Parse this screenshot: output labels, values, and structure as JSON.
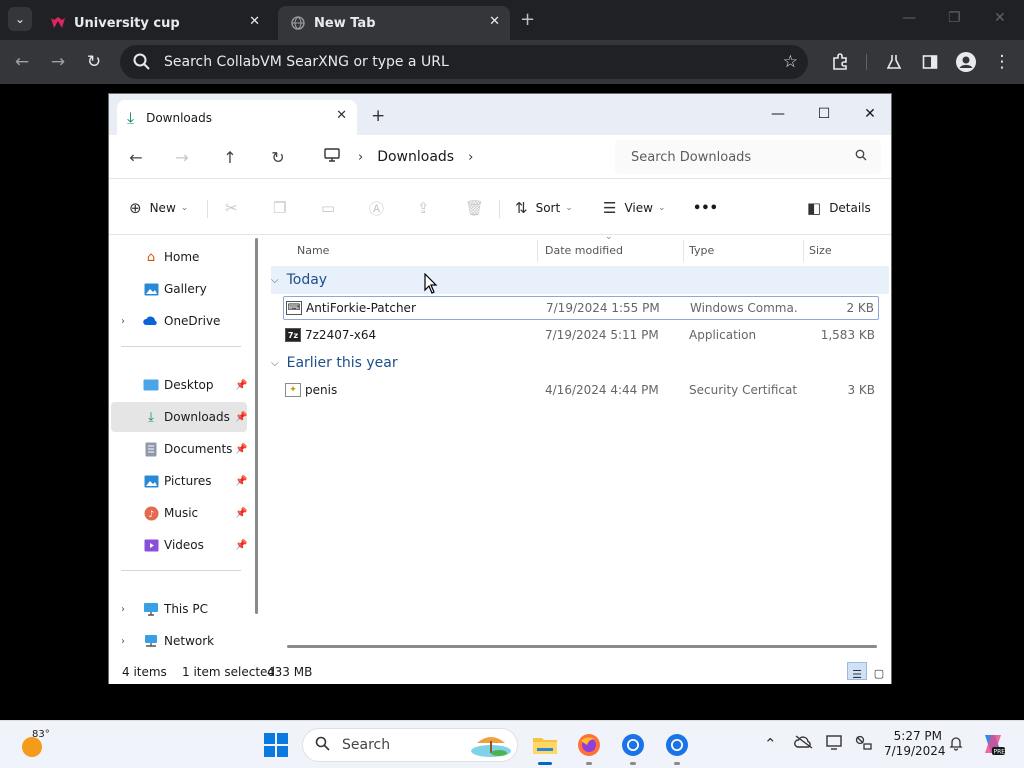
{
  "browser": {
    "tabs": [
      {
        "title": "University cup",
        "active": false
      },
      {
        "title": "New Tab",
        "active": true
      }
    ],
    "omnibox_placeholder": "Search CollabVM SearXNG or type a URL"
  },
  "explorer": {
    "tab_title": "Downloads",
    "address": {
      "location": "Downloads"
    },
    "search_placeholder": "Search Downloads",
    "commands": {
      "new": "New",
      "sort": "Sort",
      "view": "View",
      "more": "•••",
      "details": "Details"
    },
    "sidebar": {
      "items": [
        {
          "label": "Home",
          "icon": "home-icon",
          "expandable": false,
          "pinned": false
        },
        {
          "label": "Gallery",
          "icon": "gallery-icon",
          "expandable": false,
          "pinned": false
        },
        {
          "label": "OneDrive",
          "icon": "onedrive-icon",
          "expandable": true,
          "pinned": false
        },
        {
          "label": "Desktop",
          "icon": "desktop-icon",
          "expandable": false,
          "pinned": true
        },
        {
          "label": "Downloads",
          "icon": "downloads-icon",
          "expandable": false,
          "pinned": true,
          "selected": true
        },
        {
          "label": "Documents",
          "icon": "documents-icon",
          "expandable": false,
          "pinned": true
        },
        {
          "label": "Pictures",
          "icon": "pictures-icon",
          "expandable": false,
          "pinned": true
        },
        {
          "label": "Music",
          "icon": "music-icon",
          "expandable": false,
          "pinned": true
        },
        {
          "label": "Videos",
          "icon": "videos-icon",
          "expandable": false,
          "pinned": true
        },
        {
          "label": "This PC",
          "icon": "this-pc-icon",
          "expandable": true,
          "pinned": false
        },
        {
          "label": "Network",
          "icon": "network-icon",
          "expandable": true,
          "pinned": false
        }
      ]
    },
    "columns": {
      "name": "Name",
      "date": "Date modified",
      "type": "Type",
      "size": "Size"
    },
    "groups": [
      {
        "label": "Today",
        "files": [
          {
            "name": "AntiForkie-Patcher",
            "date": "7/19/2024 1:55 PM",
            "type": "Windows Comma...",
            "size": "2 KB",
            "icon": "command-script-icon",
            "selected": true
          },
          {
            "name": "7z2407-x64",
            "date": "7/19/2024 5:11 PM",
            "type": "Application",
            "size": "1,583 KB",
            "icon": "7zip-installer-icon",
            "selected": false
          }
        ]
      },
      {
        "label": "Earlier this year",
        "files": [
          {
            "name": "penis",
            "date": "4/16/2024 4:44 PM",
            "type": "Security Certificate",
            "size": "3 KB",
            "icon": "certificate-icon",
            "selected": false
          }
        ]
      }
    ],
    "status": {
      "items": "4 items",
      "selected": "1 item selected",
      "size": "433 MB"
    }
  },
  "taskbar": {
    "weather_temp": "83°",
    "search_placeholder": "Search",
    "time": "5:27 PM",
    "date": "7/19/2024"
  }
}
